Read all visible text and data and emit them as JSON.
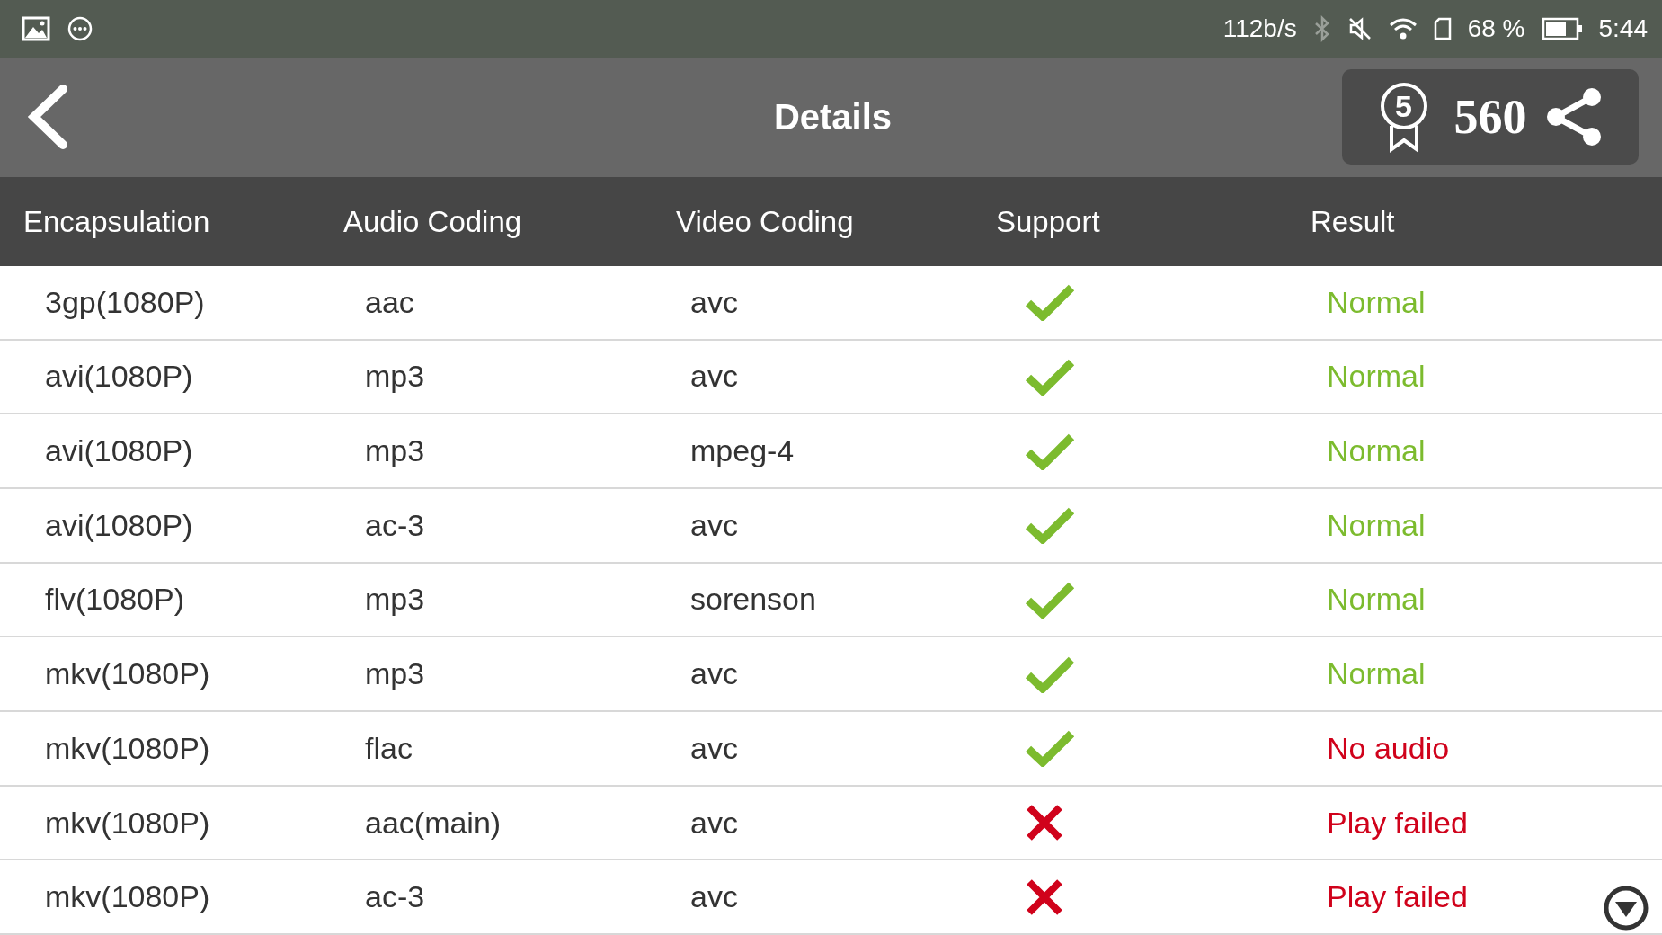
{
  "status_bar": {
    "speed": "112b/s",
    "battery_percent": "68 %",
    "time": "5:44"
  },
  "header": {
    "title": "Details",
    "badge_level": "5",
    "score": "560"
  },
  "table": {
    "columns": [
      "Encapsulation",
      "Audio Coding",
      "Video Coding",
      "Support",
      "Result"
    ],
    "rows": [
      {
        "encapsulation": "3gp(1080P)",
        "audio": "aac",
        "video": "avc",
        "supported": true,
        "result": "Normal",
        "color": "#7cbb2e"
      },
      {
        "encapsulation": "avi(1080P)",
        "audio": "mp3",
        "video": "avc",
        "supported": true,
        "result": "Normal",
        "color": "#7cbb2e"
      },
      {
        "encapsulation": "avi(1080P)",
        "audio": "mp3",
        "video": "mpeg-4",
        "supported": true,
        "result": "Normal",
        "color": "#7cbb2e"
      },
      {
        "encapsulation": "avi(1080P)",
        "audio": "ac-3",
        "video": "avc",
        "supported": true,
        "result": "Normal",
        "color": "#7cbb2e"
      },
      {
        "encapsulation": "flv(1080P)",
        "audio": "mp3",
        "video": "sorenson",
        "supported": true,
        "result": "Normal",
        "color": "#7cbb2e"
      },
      {
        "encapsulation": "mkv(1080P)",
        "audio": "mp3",
        "video": "avc",
        "supported": true,
        "result": "Normal",
        "color": "#7cbb2e"
      },
      {
        "encapsulation": "mkv(1080P)",
        "audio": "flac",
        "video": "avc",
        "supported": true,
        "result": "No audio",
        "color": "#d0021b"
      },
      {
        "encapsulation": "mkv(1080P)",
        "audio": "aac(main)",
        "video": "avc",
        "supported": false,
        "result": "Play failed",
        "color": "#d0021b"
      },
      {
        "encapsulation": "mkv(1080P)",
        "audio": "ac-3",
        "video": "avc",
        "supported": false,
        "result": "Play failed",
        "color": "#d0021b"
      }
    ]
  }
}
